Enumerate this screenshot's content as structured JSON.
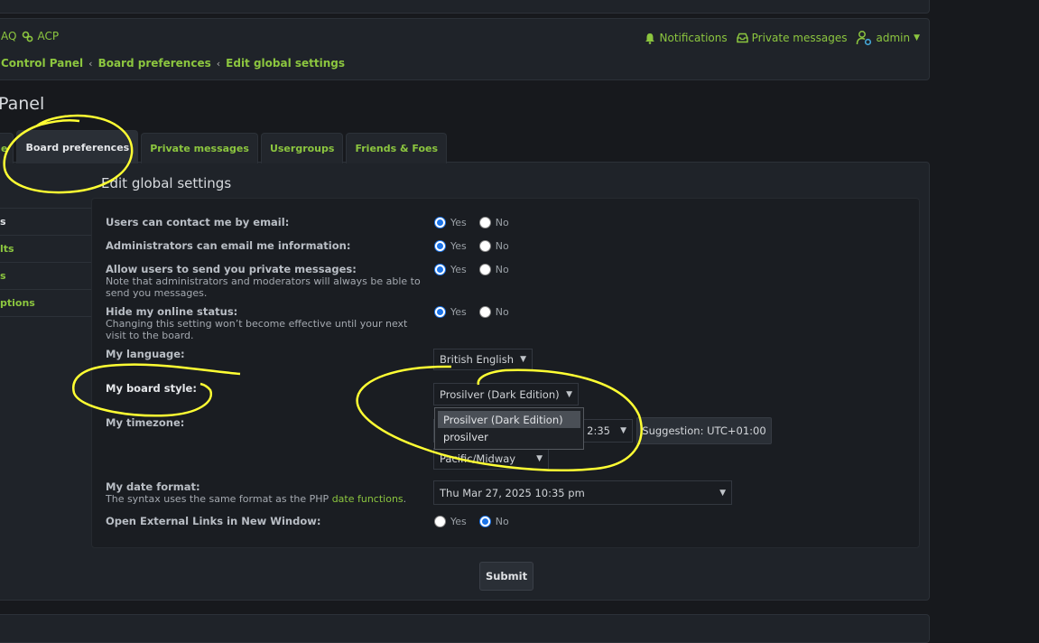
{
  "nav": {
    "faq_partial": "AQ",
    "acp": "ACP",
    "notifications": "Notifications",
    "private_messages": "Private messages",
    "user": "admin"
  },
  "breadcrumbs": [
    "Control Panel",
    "Board preferences",
    "Edit global settings"
  ],
  "page_heading": "Panel",
  "tabs": [
    {
      "label": "e"
    },
    {
      "label": "Board preferences",
      "active": true
    },
    {
      "label": "Private messages"
    },
    {
      "label": "Usergroups"
    },
    {
      "label": "Friends & Foes"
    }
  ],
  "sidebar": [
    "s",
    "lts",
    "s",
    "ptions"
  ],
  "section_title": "Edit global settings",
  "radio_labels": {
    "yes": "Yes",
    "no": "No"
  },
  "settings": {
    "contact_email": {
      "label": "Users can contact me by email:",
      "value": "Yes"
    },
    "admin_email": {
      "label": "Administrators can email me information:",
      "value": "Yes"
    },
    "allow_pm": {
      "label": "Allow users to send you private messages:",
      "explain": "Note that administrators and moderators will always be able to send you messages.",
      "value": "Yes"
    },
    "hide_online": {
      "label": "Hide my online status:",
      "explain": "Changing this setting won’t become effective until your next visit to the board.",
      "value": "Yes"
    },
    "language": {
      "label": "My language:",
      "value": "British English"
    },
    "style": {
      "label": "My board style:",
      "value": "Prosilver (Dark Edition)",
      "options": [
        "Prosilver (Dark Edition)",
        "prosilver"
      ]
    },
    "timezone": {
      "label": "My timezone:",
      "time_partial": "2:35",
      "zone_value": "Pacific/Midway",
      "suggestion": "Suggestion: UTC+01:00"
    },
    "date_format": {
      "label": "My date format:",
      "explain_prefix": "The syntax uses the same format as the PHP ",
      "explain_link": "date functions",
      "explain_suffix": ".",
      "value": "Thu Mar 27, 2025 10:35 pm"
    },
    "external_links": {
      "label": "Open External Links in New Window:",
      "value": "No"
    }
  },
  "submit_label": "Submit",
  "colors": {
    "accent": "#8cc63f",
    "annotation": "#ffff33",
    "radio": "#1a73e8"
  }
}
